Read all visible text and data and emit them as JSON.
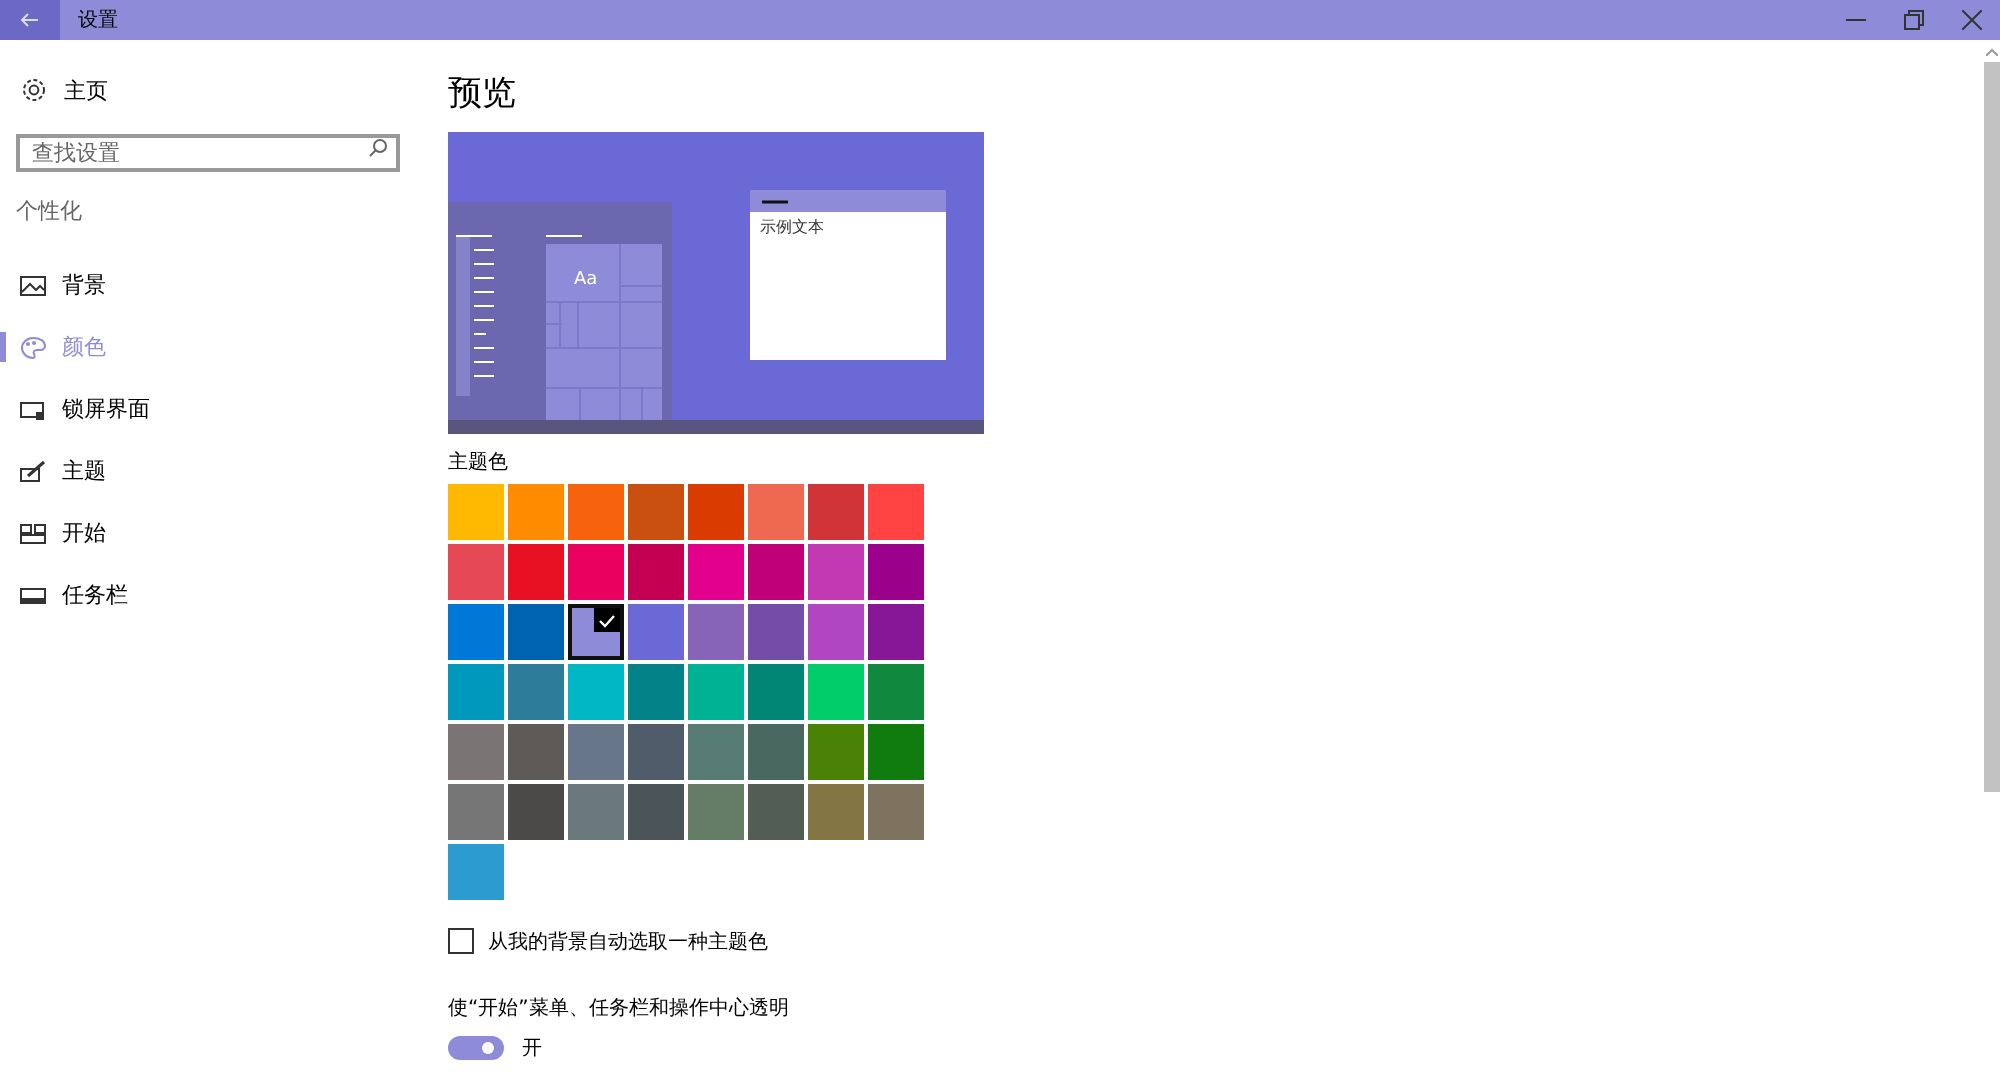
{
  "window": {
    "title": "设置"
  },
  "sidebar": {
    "home": "主页",
    "search": {
      "placeholder": "查找设置"
    },
    "section": "个性化",
    "items": [
      {
        "label": "背景",
        "selected": false
      },
      {
        "label": "颜色",
        "selected": true
      },
      {
        "label": "锁屏界面",
        "selected": false
      },
      {
        "label": "主题",
        "selected": false
      },
      {
        "label": "开始",
        "selected": false
      },
      {
        "label": "任务栏",
        "selected": false
      }
    ]
  },
  "page": {
    "title": "预览",
    "preview": {
      "tile_text": "Aa",
      "window_text": "示例文本"
    },
    "accent_label": "主题色",
    "swatches": [
      {
        "color": "#ffb900",
        "selected": false
      },
      {
        "color": "#ff8c00",
        "selected": false
      },
      {
        "color": "#f7630c",
        "selected": false
      },
      {
        "color": "#ca5010",
        "selected": false
      },
      {
        "color": "#da3b01",
        "selected": false
      },
      {
        "color": "#ef6950",
        "selected": false
      },
      {
        "color": "#d13438",
        "selected": false
      },
      {
        "color": "#ff4343",
        "selected": false
      },
      {
        "color": "#e74856",
        "selected": false
      },
      {
        "color": "#e81123",
        "selected": false
      },
      {
        "color": "#ea005e",
        "selected": false
      },
      {
        "color": "#c30052",
        "selected": false
      },
      {
        "color": "#e3008c",
        "selected": false
      },
      {
        "color": "#bf0077",
        "selected": false
      },
      {
        "color": "#c239b3",
        "selected": false
      },
      {
        "color": "#9a0089",
        "selected": false
      },
      {
        "color": "#0078d7",
        "selected": false
      },
      {
        "color": "#0063b1",
        "selected": false
      },
      {
        "color": "#8e8cd8",
        "selected": true
      },
      {
        "color": "#6b69d6",
        "selected": false
      },
      {
        "color": "#8764b8",
        "selected": false
      },
      {
        "color": "#744da9",
        "selected": false
      },
      {
        "color": "#b146c2",
        "selected": false
      },
      {
        "color": "#881798",
        "selected": false
      },
      {
        "color": "#0099bc",
        "selected": false
      },
      {
        "color": "#2d7d9a",
        "selected": false
      },
      {
        "color": "#00b7c3",
        "selected": false
      },
      {
        "color": "#038387",
        "selected": false
      },
      {
        "color": "#00b294",
        "selected": false
      },
      {
        "color": "#018574",
        "selected": false
      },
      {
        "color": "#00cc6a",
        "selected": false
      },
      {
        "color": "#10893e",
        "selected": false
      },
      {
        "color": "#7a7574",
        "selected": false
      },
      {
        "color": "#5d5a58",
        "selected": false
      },
      {
        "color": "#68768a",
        "selected": false
      },
      {
        "color": "#515c6b",
        "selected": false
      },
      {
        "color": "#567c73",
        "selected": false
      },
      {
        "color": "#486860",
        "selected": false
      },
      {
        "color": "#498205",
        "selected": false
      },
      {
        "color": "#107c10",
        "selected": false
      },
      {
        "color": "#767676",
        "selected": false
      },
      {
        "color": "#4c4a48",
        "selected": false
      },
      {
        "color": "#69797e",
        "selected": false
      },
      {
        "color": "#4a5459",
        "selected": false
      },
      {
        "color": "#647c64",
        "selected": false
      },
      {
        "color": "#525e54",
        "selected": false
      },
      {
        "color": "#847545",
        "selected": false
      },
      {
        "color": "#7e735f",
        "selected": false
      },
      {
        "color": "#2b9bd0",
        "selected": false
      }
    ],
    "auto_pick": {
      "label": "从我的背景自动选取一种主题色",
      "checked": false
    },
    "transparency": {
      "label": "使“开始”菜单、任务栏和操作中心透明",
      "on": true,
      "state_text": "开"
    }
  }
}
